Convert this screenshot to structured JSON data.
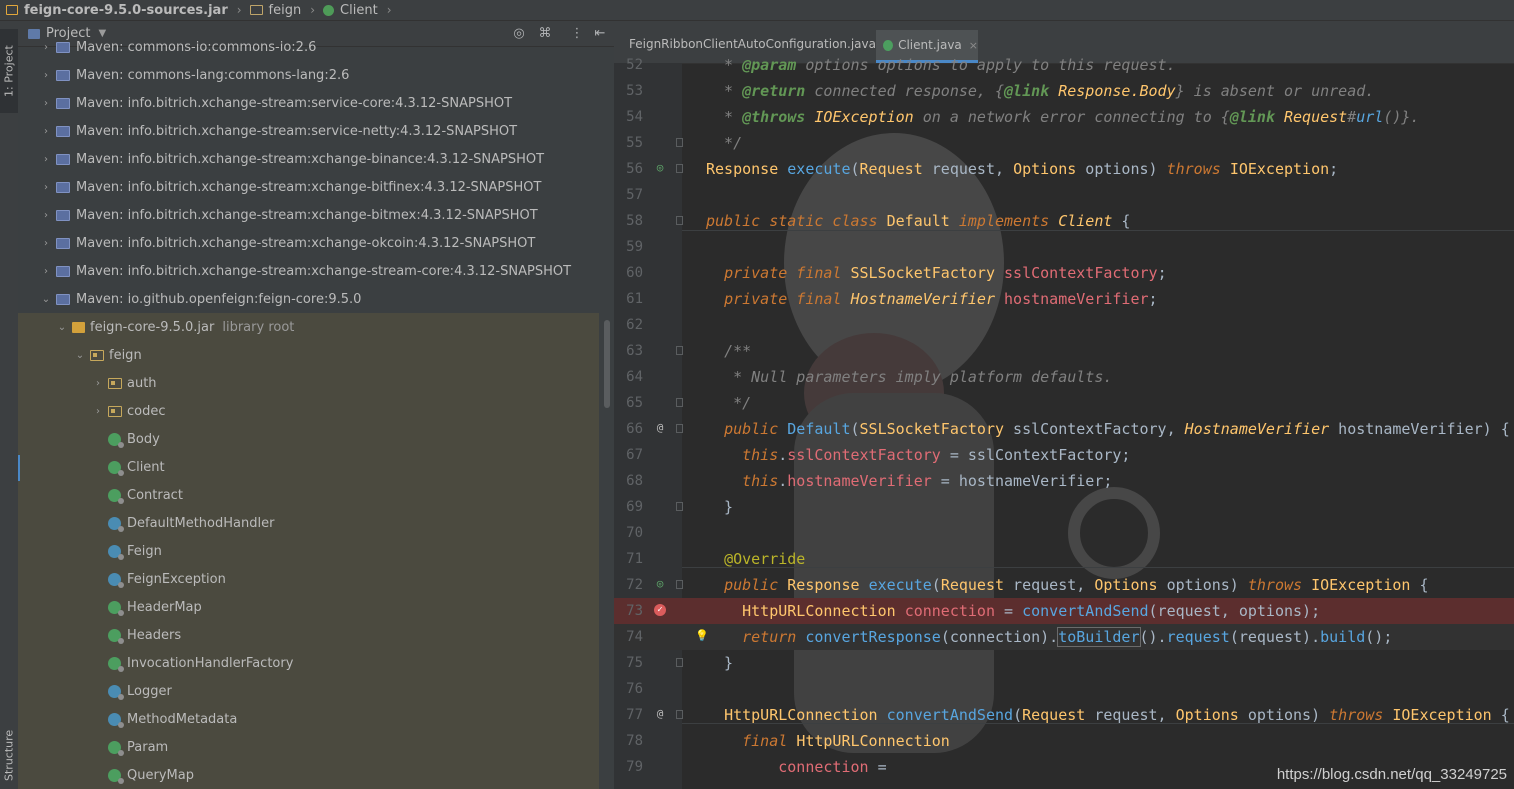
{
  "breadcrumb": {
    "jar": "feign-core-9.5.0-sources.jar",
    "package": "feign",
    "class": "Client"
  },
  "left_strip": {
    "project_tab": "1: Project",
    "structure_tab": "Structure"
  },
  "project_panel": {
    "title": "Project",
    "tree": [
      {
        "label": "Maven: commons-io:commons-io:2.6",
        "kind": "lib",
        "depth": 0,
        "arrow": "›"
      },
      {
        "label": "Maven: commons-lang:commons-lang:2.6",
        "kind": "lib",
        "depth": 0,
        "arrow": "›"
      },
      {
        "label": "Maven: info.bitrich.xchange-stream:service-core:4.3.12-SNAPSHOT",
        "kind": "lib",
        "depth": 0,
        "arrow": "›"
      },
      {
        "label": "Maven: info.bitrich.xchange-stream:service-netty:4.3.12-SNAPSHOT",
        "kind": "lib",
        "depth": 0,
        "arrow": "›"
      },
      {
        "label": "Maven: info.bitrich.xchange-stream:xchange-binance:4.3.12-SNAPSHOT",
        "kind": "lib",
        "depth": 0,
        "arrow": "›"
      },
      {
        "label": "Maven: info.bitrich.xchange-stream:xchange-bitfinex:4.3.12-SNAPSHOT",
        "kind": "lib",
        "depth": 0,
        "arrow": "›"
      },
      {
        "label": "Maven: info.bitrich.xchange-stream:xchange-bitmex:4.3.12-SNAPSHOT",
        "kind": "lib",
        "depth": 0,
        "arrow": "›"
      },
      {
        "label": "Maven: info.bitrich.xchange-stream:xchange-okcoin:4.3.12-SNAPSHOT",
        "kind": "lib",
        "depth": 0,
        "arrow": "›"
      },
      {
        "label": "Maven: info.bitrich.xchange-stream:xchange-stream-core:4.3.12-SNAPSHOT",
        "kind": "lib",
        "depth": 0,
        "arrow": "›"
      },
      {
        "label": "Maven: io.github.openfeign:feign-core:9.5.0",
        "kind": "lib",
        "depth": 0,
        "arrow": "⌄"
      },
      {
        "label": "feign-core-9.5.0.jar",
        "extra": "library root",
        "kind": "jar",
        "depth": 1,
        "arrow": "⌄"
      },
      {
        "label": "feign",
        "kind": "pkg",
        "depth": 2,
        "arrow": "⌄"
      },
      {
        "label": "auth",
        "kind": "pkg",
        "depth": 3,
        "arrow": "›"
      },
      {
        "label": "codec",
        "kind": "pkg",
        "depth": 3,
        "arrow": "›"
      },
      {
        "label": "Body",
        "kind": "iface",
        "depth": 3,
        "arrow": ""
      },
      {
        "label": "Client",
        "kind": "iface",
        "depth": 3,
        "arrow": ""
      },
      {
        "label": "Contract",
        "kind": "iface",
        "depth": 3,
        "arrow": ""
      },
      {
        "label": "DefaultMethodHandler",
        "kind": "cls",
        "depth": 3,
        "arrow": ""
      },
      {
        "label": "Feign",
        "kind": "cls",
        "depth": 3,
        "arrow": ""
      },
      {
        "label": "FeignException",
        "kind": "cls",
        "depth": 3,
        "arrow": ""
      },
      {
        "label": "HeaderMap",
        "kind": "iface",
        "depth": 3,
        "arrow": ""
      },
      {
        "label": "Headers",
        "kind": "iface",
        "depth": 3,
        "arrow": ""
      },
      {
        "label": "InvocationHandlerFactory",
        "kind": "iface",
        "depth": 3,
        "arrow": ""
      },
      {
        "label": "Logger",
        "kind": "cls",
        "depth": 3,
        "arrow": ""
      },
      {
        "label": "MethodMetadata",
        "kind": "cls",
        "depth": 3,
        "arrow": ""
      },
      {
        "label": "Param",
        "kind": "iface",
        "depth": 3,
        "arrow": ""
      },
      {
        "label": "QueryMap",
        "kind": "iface",
        "depth": 3,
        "arrow": ""
      }
    ]
  },
  "editor": {
    "tabs": [
      {
        "label": "FeignRibbonClientAutoConfiguration.java",
        "close": "×"
      },
      {
        "label": "Client.java",
        "close": "×"
      }
    ],
    "lines": [
      {
        "n": "52",
        "html": "<span class='cm'>  * </span><span class='ctag'>@param</span><span class='cm'> options options to apply to this request.</span>"
      },
      {
        "n": "53",
        "html": "<span class='cm'>  * </span><span class='ctag'>@return</span><span class='cm'> connected response, {</span><span class='ctag'>@link</span><span class='cm'> </span><span class='iface'>Response.Body</span><span class='cm'>} is absent or unread.</span>"
      },
      {
        "n": "54",
        "html": "<span class='cm'>  * </span><span class='ctag'>@throws</span><span class='cm'> </span><span class='iface'>IOException</span><span class='cm'> on a network error connecting to {</span><span class='ctag'>@link</span><span class='cm'> </span><span class='iface'>Request</span><span class='cm'>#</span><span class='fn' style='font-style:italic'>url</span><span class='cm'>()}.</span>"
      },
      {
        "n": "55",
        "html": "<span class='cm'>  */</span>"
      },
      {
        "n": "56",
        "html": "<span class='tp'>Response</span> <span class='fn'>execute</span>(<span class='tp'>Request</span> request, <span class='tp'>Options</span> options) <span class='kw'>throws</span> <span class='tp'>IOException</span>;"
      },
      {
        "n": "57",
        "html": ""
      },
      {
        "n": "58",
        "html": "<span class='kw'>public static class</span> <span class='tp'>Default</span> <span class='kw'>implements</span> <span class='iface'>Client</span> {"
      },
      {
        "n": "59",
        "html": ""
      },
      {
        "n": "60",
        "html": "  <span class='kw'>private final</span> <span class='tp'>SSLSocketFactory</span> <span class='fld'>sslContextFactory</span>;"
      },
      {
        "n": "61",
        "html": "  <span class='kw'>private final</span> <span class='iface'>HostnameVerifier</span> <span class='fld'>hostnameVerifier</span>;"
      },
      {
        "n": "62",
        "html": ""
      },
      {
        "n": "63",
        "html": "  <span class='cm'>/**</span>"
      },
      {
        "n": "64",
        "html": "<span class='cm'>   * Null parameters imply platform defaults.</span>"
      },
      {
        "n": "65",
        "html": "<span class='cm'>   */</span>"
      },
      {
        "n": "66",
        "html": "  <span class='kw'>public</span> <span class='fn'>Default</span>(<span class='tp'>SSLSocketFactory</span> sslContextFactory, <span class='iface'>HostnameVerifier</span> hostnameVerifier) {"
      },
      {
        "n": "67",
        "html": "    <span class='kw'>this</span>.<span class='fld'>sslContextFactory</span> = sslContextFactory;"
      },
      {
        "n": "68",
        "html": "    <span class='kw'>this</span>.<span class='fld'>hostnameVerifier</span> = hostnameVerifier;"
      },
      {
        "n": "69",
        "html": "  }"
      },
      {
        "n": "70",
        "html": ""
      },
      {
        "n": "71",
        "html": "  <span class='an'>@Override</span>"
      },
      {
        "n": "72",
        "html": "  <span class='kw'>public</span> <span class='tp'>Response</span> <span class='fn'>execute</span>(<span class='tp'>Request</span> request, <span class='tp'>Options</span> options) <span class='kw'>throws</span> <span class='tp'>IOException</span> {"
      },
      {
        "n": "73",
        "html": "    <span class='tp'>HttpURLConnection</span> <span class='fld'>connection</span> = <span class='fn'>convertAndSend</span>(request, options);"
      },
      {
        "n": "74",
        "html": "    <span class='kw'>return</span> <span class='fn'>convertResponse</span>(connection).<span class='fn' style='outline:1px solid #6b6b6b'>toBuilder</span>().<span class='fn'>request</span>(request).<span class='fn'>build</span>();"
      },
      {
        "n": "75",
        "html": "  }"
      },
      {
        "n": "76",
        "html": ""
      },
      {
        "n": "77",
        "html": "  <span class='tp'>HttpURLConnection</span> <span class='fn'>convertAndSend</span>(<span class='tp'>Request</span> request, <span class='tp'>Options</span> options) <span class='kw'>throws</span> <span class='tp'>IOException</span> {"
      },
      {
        "n": "78",
        "html": "    <span class='kw'>final</span> <span class='tp'>HttpURLConnection</span>"
      },
      {
        "n": "79",
        "html": "        <span class='fld'>connection</span> ="
      }
    ]
  },
  "watermark": "https://blog.csdn.net/qq_33249725"
}
